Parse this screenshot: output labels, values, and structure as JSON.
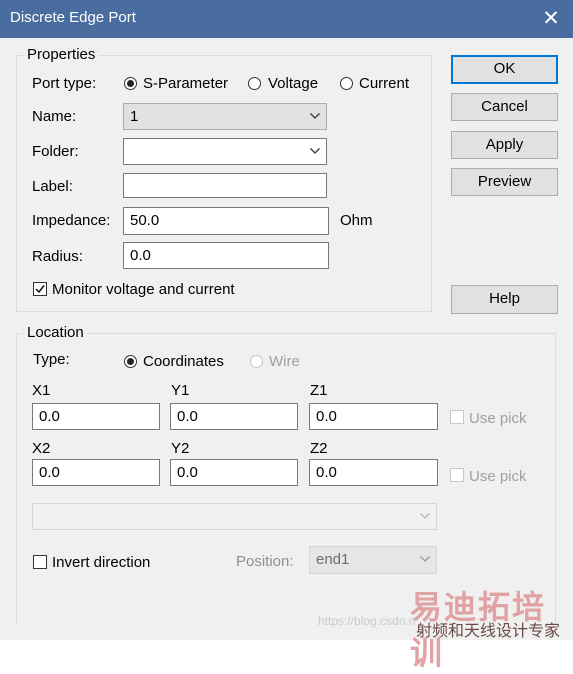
{
  "dialog": {
    "title": "Discrete Edge Port"
  },
  "buttons": {
    "ok": "OK",
    "cancel": "Cancel",
    "apply": "Apply",
    "preview": "Preview",
    "help": "Help"
  },
  "properties": {
    "legend": "Properties",
    "port_type_label": "Port type:",
    "port_types": [
      "S-Parameter",
      "Voltage",
      "Current"
    ],
    "port_type_selected": "S-Parameter",
    "name_label": "Name:",
    "name_value": "1",
    "folder_label": "Folder:",
    "folder_value": "",
    "label_label": "Label:",
    "label_value": "",
    "impedance_label": "Impedance:",
    "impedance_value": "50.0",
    "impedance_unit": "Ohm",
    "radius_label": "Radius:",
    "radius_value": "0.0",
    "monitor_label": "Monitor voltage and current",
    "monitor_checked": true
  },
  "location": {
    "legend": "Location",
    "type_label": "Type:",
    "type_options": [
      "Coordinates",
      "Wire"
    ],
    "type_selected": "Coordinates",
    "x1_label": "X1",
    "y1_label": "Y1",
    "z1_label": "Z1",
    "x1": "0.0",
    "y1": "0.0",
    "z1": "0.0",
    "x2_label": "X2",
    "y2_label": "Y2",
    "z2_label": "Z2",
    "x2": "0.0",
    "y2": "0.0",
    "z2": "0.0",
    "use_pick_label": "Use pick",
    "wire_value": "",
    "invert_label": "Invert direction",
    "invert_checked": false,
    "position_label": "Position:",
    "position_value": "end1"
  },
  "watermark": {
    "url": "https://blog.csdn.n",
    "brand": "易迪拓培训",
    "subtitle": "射频和天线设计专家"
  }
}
